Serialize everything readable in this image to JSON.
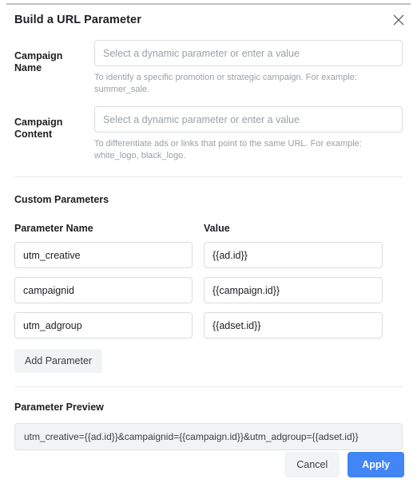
{
  "dialog": {
    "title": "Build a URL Parameter",
    "close_icon": "close-icon"
  },
  "fields": [
    {
      "label": "Campaign Name",
      "value": "",
      "placeholder": "Select a dynamic parameter or enter a value",
      "helper": "To identify a specific promotion or strategic campaign. For example: summer_sale."
    },
    {
      "label": "Campaign Content",
      "value": "",
      "placeholder": "Select a dynamic parameter or enter a value",
      "helper": "To differentiate ads or links that point to the same URL. For example: white_logo, black_logo."
    }
  ],
  "custom_parameters": {
    "section_title": "Custom Parameters",
    "columns": {
      "name": "Parameter Name",
      "value": "Value"
    },
    "rows": [
      {
        "name": "utm_creative",
        "value": "{{ad.id}}"
      },
      {
        "name": "campaignid",
        "value": "{{campaign.id}}"
      },
      {
        "name": "utm_adgroup",
        "value": "{{adset.id}}"
      }
    ],
    "add_button": "Add Parameter"
  },
  "preview": {
    "title": "Parameter Preview",
    "text": "utm_creative={{ad.id}}&campaignid={{campaign.id}}&utm_adgroup={{adset.id}}"
  },
  "footer": {
    "cancel": "Cancel",
    "apply": "Apply"
  },
  "colors": {
    "accent": "#4285f4",
    "border": "#dadce0",
    "muted_text": "#9aa0a6",
    "surface": "#f1f3f4",
    "text": "#202124"
  }
}
